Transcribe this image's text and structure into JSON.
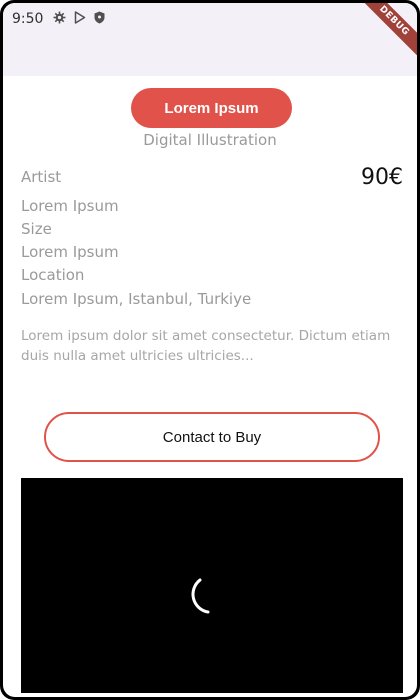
{
  "status_bar": {
    "time": "9:50",
    "icons": [
      "gear-icon",
      "play-store-icon",
      "shield-icon"
    ]
  },
  "debug_banner": "DEBUG",
  "artwork": {
    "name": "Lorem Ipsum",
    "category": "Digital Illustration",
    "price": "90€",
    "artist_label": "Artist",
    "artist_value": "Lorem Ipsum",
    "size_label": "Size",
    "size_value": "Lorem Ipsum",
    "location_label": "Location",
    "location_value": "Lorem Ipsum, Istanbul, Turkiye",
    "description": "Lorem ipsum dolor sit amet consectetur. Dictum etiam duis nulla amet ultricies ultricies..."
  },
  "actions": {
    "contact_label": "Contact to Buy"
  },
  "colors": {
    "accent": "#e0524a",
    "muted_text": "#9a9a9a",
    "app_bar": "#f4f0f7"
  }
}
